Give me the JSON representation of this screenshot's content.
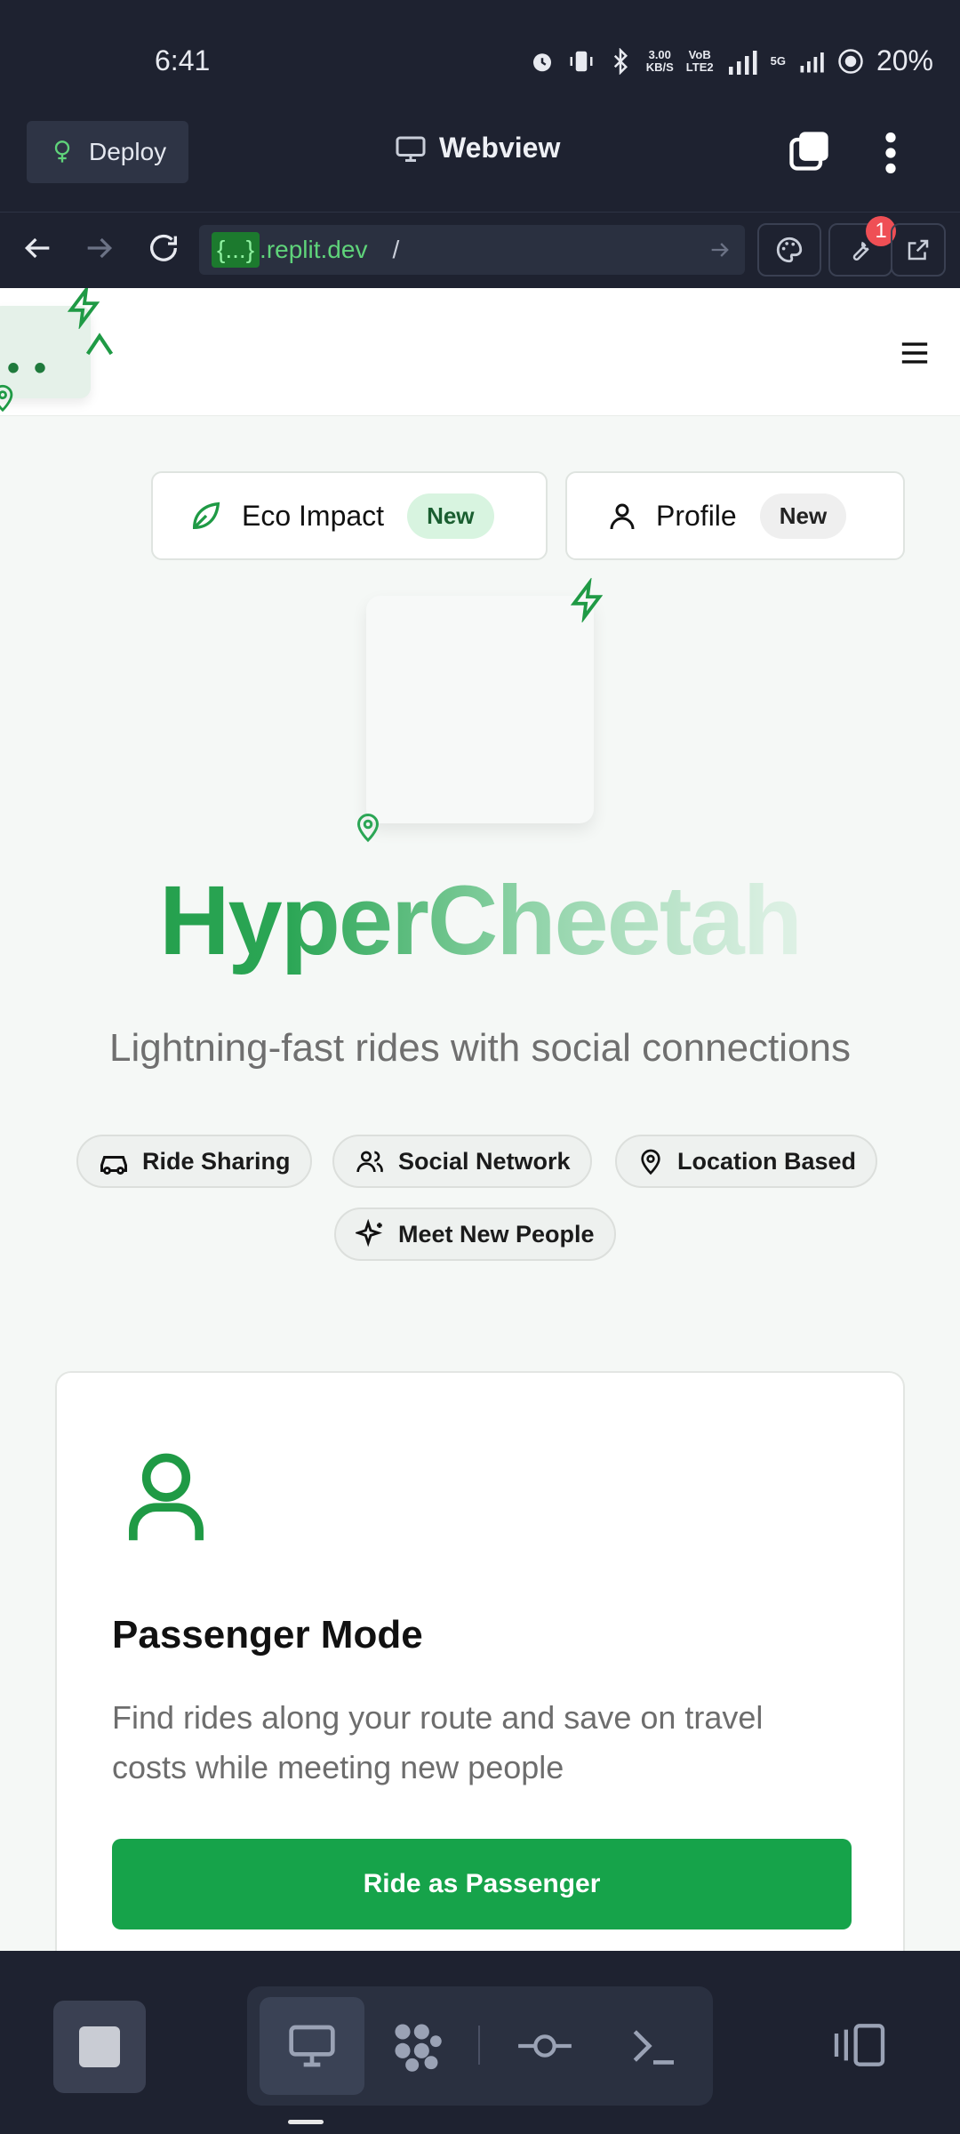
{
  "status_bar": {
    "time": "6:41",
    "net_speed_top": "3.00",
    "net_speed_bottom": "KB/S",
    "volte_top": "VoB",
    "volte_bottom": "LTE2",
    "fiveg": "5G",
    "battery": "20%"
  },
  "topbar": {
    "deploy_label": "Deploy",
    "title": "Webview"
  },
  "urlbar": {
    "brace": "{...}",
    "host": ".replit.dev",
    "path": "/",
    "notification_count": "1"
  },
  "site": {
    "nav_buttons": [
      {
        "label": "Eco Impact",
        "badge": "New",
        "badge_color": "#d8f4e0"
      },
      {
        "label": "Profile",
        "badge": "New",
        "badge_color": "#efefef"
      }
    ],
    "hero_title": "HyperCheetah",
    "hero_subtitle": "Lightning-fast rides with social connections",
    "tags": [
      {
        "label": "Ride Sharing",
        "icon": "car-icon"
      },
      {
        "label": "Social Network",
        "icon": "users-icon"
      },
      {
        "label": "Location Based",
        "icon": "map-pin-icon"
      },
      {
        "label": "Meet New People",
        "icon": "sparkles-icon"
      }
    ],
    "mode_card": {
      "title": "Passenger Mode",
      "description": "Find rides along your route and save on travel costs while meeting new people",
      "button_label": "Ride as Passenger"
    },
    "accent_color": "#16a34a"
  }
}
